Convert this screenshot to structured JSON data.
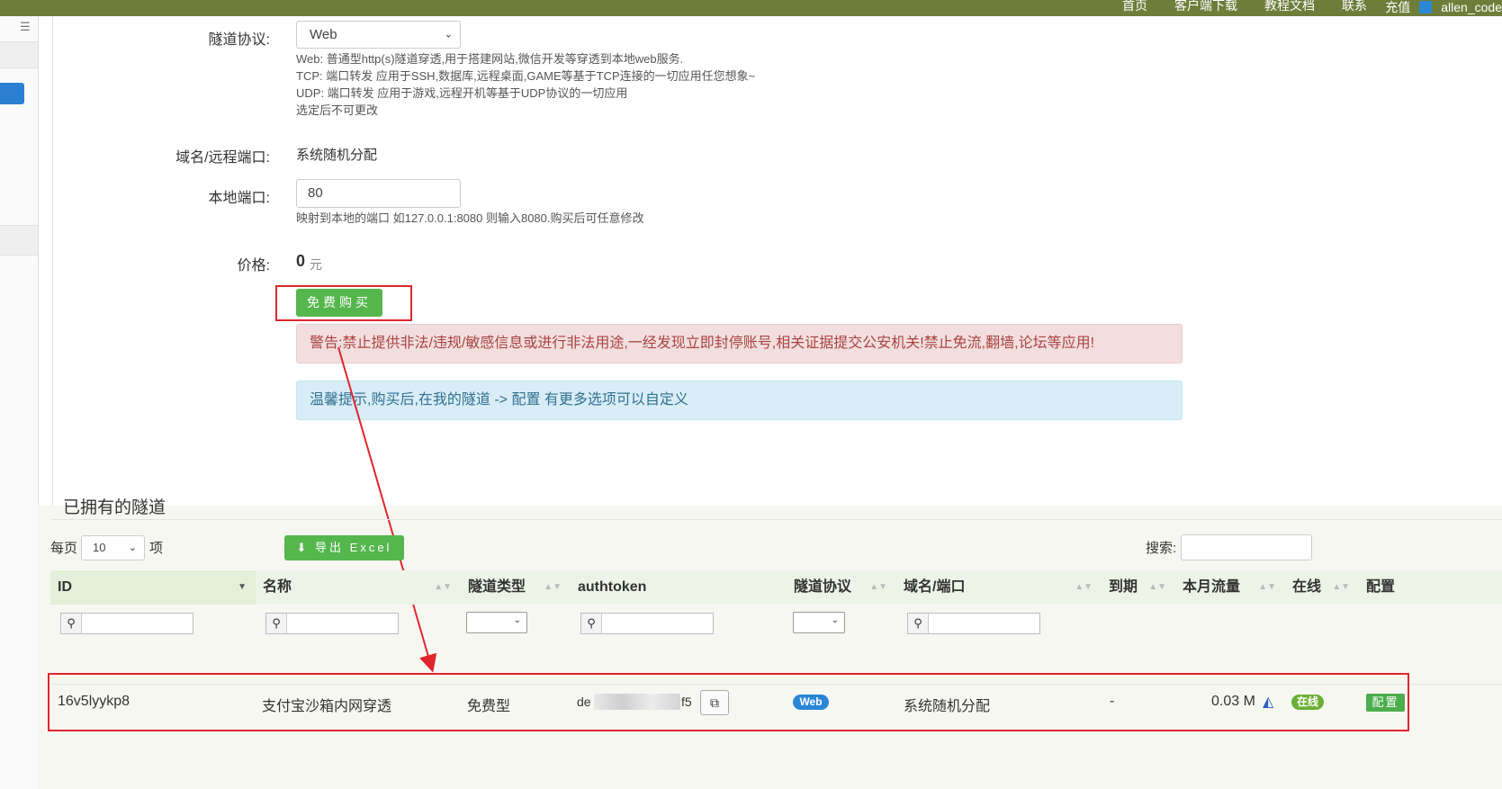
{
  "topbar": {
    "nav": [
      "首页",
      "客户端下载",
      "教程文档",
      "联系"
    ],
    "user_items": [
      "充值",
      "allen_code"
    ]
  },
  "form": {
    "protocol_label": "隧道协议:",
    "protocol_value": "Web",
    "protocol_help": [
      "Web: 普通型http(s)隧道穿透,用于搭建网站,微信开发等穿透到本地web服务.",
      "TCP: 端口转发 应用于SSH,数据库,远程桌面,GAME等基于TCP连接的一切应用任您想象~",
      "UDP: 端口转发 应用于游戏,远程开机等基于UDP协议的一切应用",
      "选定后不可更改"
    ],
    "domain_label": "域名/远程端口:",
    "domain_value": "系统随机分配",
    "local_port_label": "本地端口:",
    "local_port_value": "80",
    "local_port_help": "映射到本地的端口 如127.0.0.1:8080 则输入8080.购买后可任意修改",
    "price_label": "价格:",
    "price_value": "0",
    "price_unit": "元",
    "buy_button": "免费购买",
    "warning": "警告:禁止提供非法/违规/敏感信息或进行非法用途,一经发现立即封停账号,相关证据提交公安机关!禁止免流,翻墙,论坛等应用!",
    "tip": "温馨提示,购买后,在我的隧道 -> 配置 有更多选项可以自定义"
  },
  "owned": {
    "title": "已拥有的隧道",
    "per_page_label": "每页",
    "per_page_value": "10",
    "per_page_suffix": "项",
    "export_button": "导出 Excel",
    "search_label": "搜索:",
    "columns": [
      "ID",
      "名称",
      "隧道类型",
      "authtoken",
      "隧道协议",
      "域名/端口",
      "到期",
      "本月流量",
      "在线",
      "配置"
    ],
    "row": {
      "id": "16v5lyykp8",
      "name": "支付宝沙箱内网穿透",
      "type": "免费型",
      "token_start": "de",
      "token_end": "f5",
      "protocol": "Web",
      "domain": "系统随机分配",
      "expire": "-",
      "traffic": "0.03 M",
      "online": "在线",
      "config": "配置"
    }
  }
}
